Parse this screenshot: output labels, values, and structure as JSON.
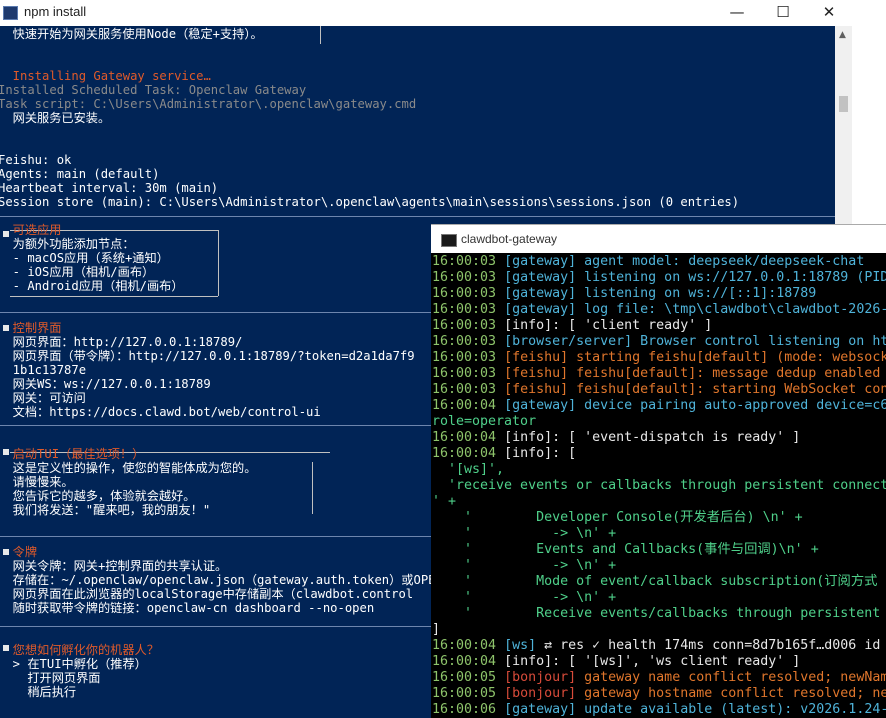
{
  "npm_window": {
    "title": "npm install",
    "controls": {
      "minimize": "—",
      "maximize": "☐",
      "close": "✕"
    },
    "lines": [
      "  快速开始为网关服务使用Node（稳定+支持）。",
      "",
      "",
      "  Installing Gateway service…",
      "Installed Scheduled Task: Openclaw Gateway",
      "Task script: C:\\Users\\Administrator\\.openclaw\\gateway.cmd",
      "  网关服务已安装。",
      "",
      "",
      "Feishu: ok",
      "Agents: main (default)",
      "Heartbeat interval: 30m (main)",
      "Session store (main): C:\\Users\\Administrator\\.openclaw\\agents\\main\\sessions\\sessions.json (0 entries)",
      "",
      "",
      "  可选应用",
      "  为额外功能添加节点：",
      "  - macOS应用（系统+通知）",
      "  - iOS应用（相机/画布）",
      "  - Android应用（相机/画布）",
      "",
      "",
      "  控制界面",
      "  网页界面：http://127.0.0.1:18789/",
      "  网页界面（带令牌）：http://127.0.0.1:18789/?token=d2a1da7f9",
      "  1b1c13787e",
      "  网关WS：ws://127.0.0.1:18789",
      "  网关：可访问",
      "  文档：https://docs.clawd.bot/web/control-ui",
      "",
      "",
      "  启动TUI（最佳选项！）",
      "  这是定义性的操作，使您的智能体成为您的。",
      "  请慢慢来。",
      "  您告诉它的越多，体验就会越好。",
      "  我们将发送：\"醒来吧，我的朋友！\"",
      "",
      "",
      "  令牌",
      "  网关令牌：网关+控制界面的共享认证。",
      "  存储在：~/.openclaw/openclaw.json（gateway.auth.token）或OPE",
      "  网页界面在此浏览器的localStorage中存储副本（clawdbot.control",
      "  随时获取带令牌的链接：openclaw-cn dashboard --no-open",
      "",
      "",
      "  您想如何孵化你的机器人？",
      "  > 在TUI中孵化（推荐）",
      "    打开网页界面",
      "    稍后执行"
    ]
  },
  "gateway_window": {
    "title": "clawdbot-gateway",
    "lines": [
      {
        "ts": "16:00:03",
        "tag": "[gateway]",
        "msg": " agent model: deepseek/deepseek-chat"
      },
      {
        "ts": "16:00:03",
        "tag": "[gateway]",
        "msg": " listening on ws://127.0.0.1:18789 (PID"
      },
      {
        "ts": "16:00:03",
        "tag": "[gateway]",
        "msg": " listening on ws://[::1]:18789"
      },
      {
        "ts": "16:00:03",
        "tag": "[gateway]",
        "msg": " log file: \\tmp\\clawdbot\\clawdbot-2026-"
      },
      {
        "ts": "16:00:03",
        "tag": "[info]:",
        "msg": " [ 'client ready' ]"
      },
      {
        "ts": "16:00:03",
        "tag": "[browser/server]",
        "msg": " Browser control listening on ht"
      },
      {
        "ts": "16:00:03",
        "tag": "[feishu]",
        "msg": " starting feishu[default] (mode: websock"
      },
      {
        "ts": "16:00:03",
        "tag": "[feishu]",
        "msg": " feishu[default]: message dedup enabled"
      },
      {
        "ts": "16:00:03",
        "tag": "[feishu]",
        "msg": " feishu[default]: starting WebSocket con"
      },
      {
        "ts": "16:00:04",
        "tag": "[gateway]",
        "msg": " device pairing auto-approved device=c6"
      },
      {
        "ts": "",
        "tag": "",
        "msg": "role=operator"
      },
      {
        "ts": "16:00:04",
        "tag": "[info]:",
        "msg": " [ 'event-dispatch is ready' ]"
      },
      {
        "ts": "16:00:04",
        "tag": "[info]:",
        "msg": " ["
      },
      {
        "ts": "",
        "tag": "",
        "msg": "  '[ws]',"
      },
      {
        "ts": "",
        "tag": "",
        "msg": "  'receive events or callbacks through persistent connect"
      },
      {
        "ts": "",
        "tag": "",
        "msg": "' +"
      },
      {
        "ts": "",
        "tag": "",
        "msg": "    '        Developer Console(开发者后台) \\n' +"
      },
      {
        "ts": "",
        "tag": "",
        "msg": "    '          -> \\n' +"
      },
      {
        "ts": "",
        "tag": "",
        "msg": "    '        Events and Callbacks(事件与回调)\\n' +"
      },
      {
        "ts": "",
        "tag": "",
        "msg": "    '          -> \\n' +"
      },
      {
        "ts": "",
        "tag": "",
        "msg": "    '        Mode of event/callback subscription(订阅方式"
      },
      {
        "ts": "",
        "tag": "",
        "msg": "    '          -> \\n' +"
      },
      {
        "ts": "",
        "tag": "",
        "msg": "    '        Receive events/callbacks through persistent "
      },
      {
        "ts": "",
        "tag": "",
        "msg": "]"
      },
      {
        "ts": "16:00:04",
        "tag": "[ws]",
        "msg": " ⇄ res ✓ health 174ms conn=8d7b165f…d006 id"
      },
      {
        "ts": "16:00:04",
        "tag": "[info]:",
        "msg": " [ '[ws]', 'ws client ready' ]"
      },
      {
        "ts": "16:00:05",
        "tag": "[bonjour]",
        "msg": " gateway name conflict resolved; newNam"
      },
      {
        "ts": "16:00:05",
        "tag": "[bonjour]",
        "msg": " gateway hostname conflict resolved; ne"
      },
      {
        "ts": "16:00:06",
        "tag": "[gateway]",
        "msg": " update available (latest): v2026.1.24-"
      }
    ]
  },
  "colors": {
    "npm_bg": "#012456",
    "gateway_bg": "#000000",
    "accent_orange": "#e05a2a",
    "accent_green": "#3ec46d"
  }
}
